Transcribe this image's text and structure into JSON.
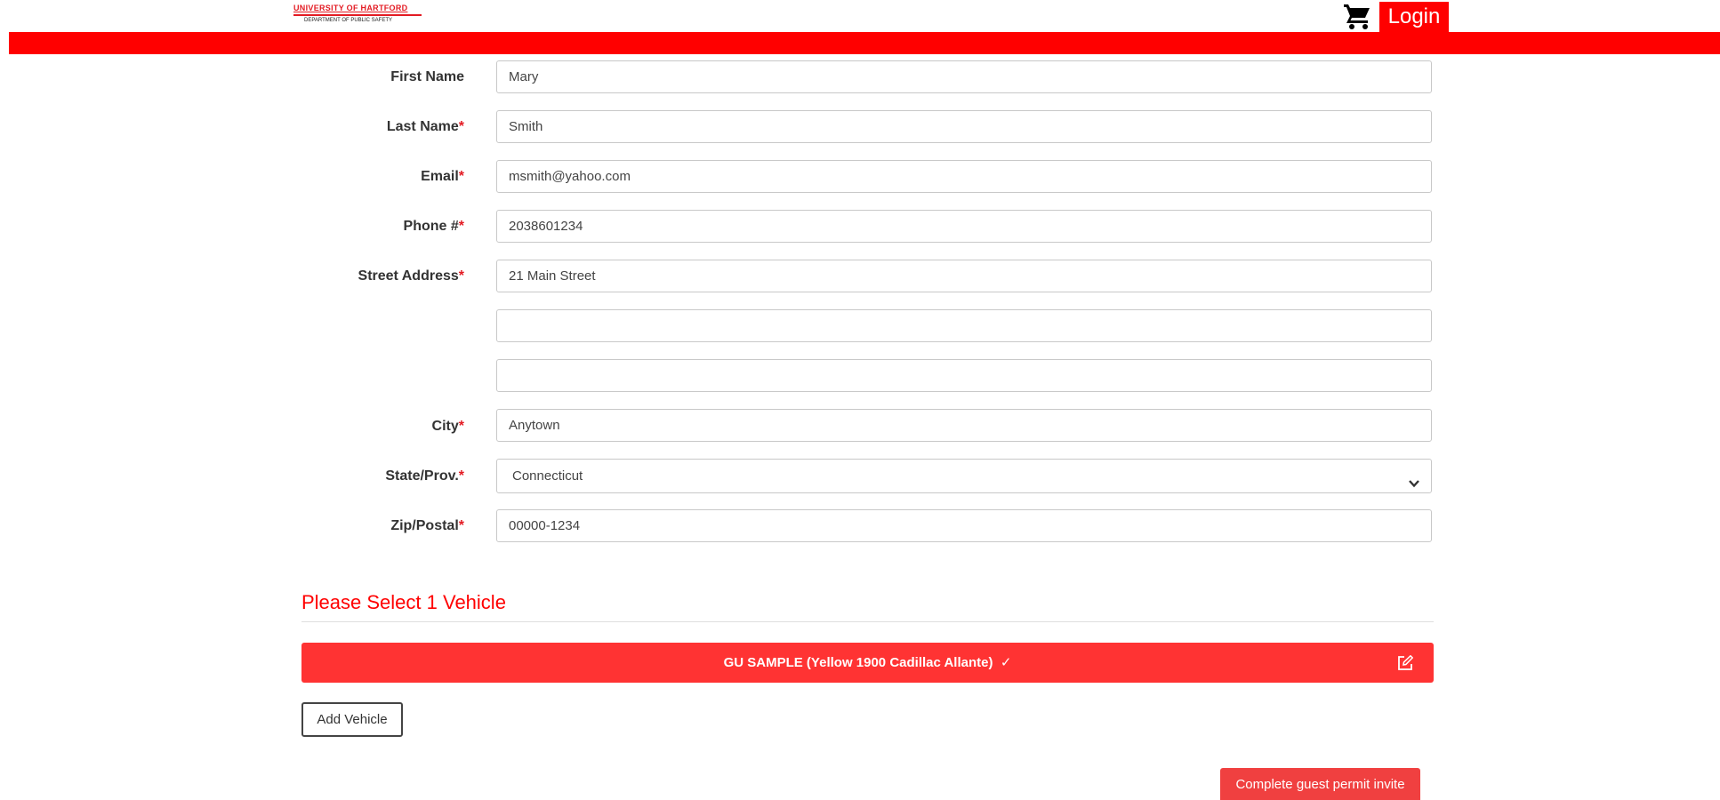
{
  "header": {
    "logo_line1": "UNIVERSITY OF HARTFORD",
    "logo_line2": "DEPARTMENT OF PUBLIC SAFETY",
    "cart_icon": "shopping-cart-icon",
    "login_label": "Login",
    "brand_color": "#ff0000"
  },
  "form": {
    "required_marker": "*",
    "first_name": {
      "label": "First Name",
      "value": "Mary"
    },
    "last_name": {
      "label": "Last Name",
      "value": "Smith"
    },
    "email": {
      "label": "Email",
      "value": "msmith@yahoo.com"
    },
    "phone": {
      "label": "Phone #",
      "value": "2038601234"
    },
    "street": {
      "label": "Street Address",
      "value": "21 Main Street",
      "line2": "",
      "line3": ""
    },
    "city": {
      "label": "City",
      "value": "Anytown"
    },
    "state": {
      "label": "State/Prov.",
      "value": "Connecticut"
    },
    "zip": {
      "label": "Zip/Postal",
      "value": "00000-1234"
    }
  },
  "vehicles": {
    "title": "Please Select 1 Vehicle",
    "selected": "GU SAMPLE (Yellow 1900 Cadillac Allante)",
    "check": "✓",
    "edit_icon": "edit-icon",
    "add_label": "Add Vehicle"
  },
  "actions": {
    "complete_label": "Complete guest permit invite"
  }
}
